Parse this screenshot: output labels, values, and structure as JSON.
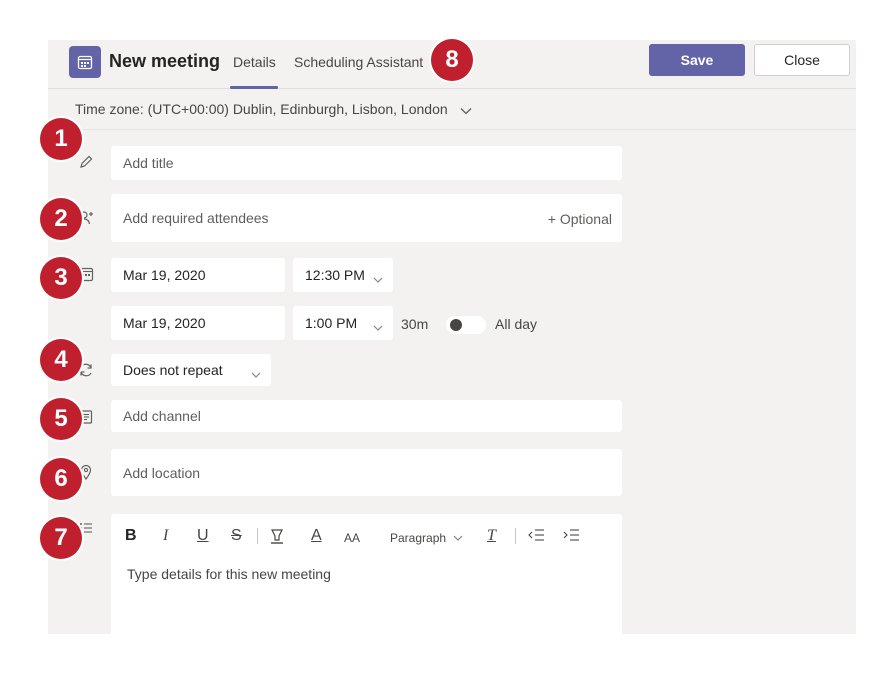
{
  "header": {
    "title": "New meeting",
    "tabs": [
      {
        "label": "Details",
        "active": true
      },
      {
        "label": "Scheduling Assistant",
        "active": false
      }
    ],
    "save_label": "Save",
    "close_label": "Close",
    "accent_color": "#6264a7"
  },
  "timezone": {
    "label": "Time zone: (UTC+00:00) Dublin, Edinburgh, Lisbon, London"
  },
  "form": {
    "title_placeholder": "Add title",
    "attendees_placeholder": "Add required attendees",
    "optional_label": "+ Optional",
    "start_date": "Mar 19, 2020",
    "start_time": "12:30 PM",
    "end_date": "Mar 19, 2020",
    "end_time": "1:00 PM",
    "duration": "30m",
    "all_day_label": "All day",
    "all_day": false,
    "repeat": "Does not repeat",
    "channel_placeholder": "Add channel",
    "location_placeholder": "Add location",
    "details_placeholder": "Type details for this new meeting"
  },
  "editor_toolbar": {
    "bold": "B",
    "italic": "I",
    "underline": "U",
    "strike": "S",
    "font_color": "A",
    "font_size": "AA",
    "paragraph": "Paragraph",
    "clear_format": "T"
  },
  "markers": [
    "1",
    "2",
    "3",
    "4",
    "5",
    "6",
    "7",
    "8"
  ],
  "marker_color": "#c0202e"
}
